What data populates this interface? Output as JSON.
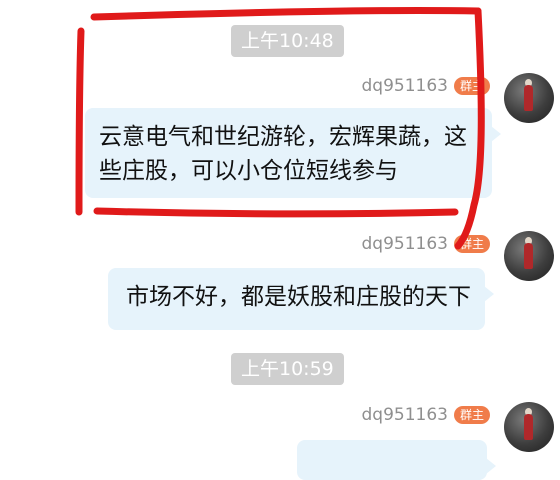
{
  "messages": [
    {
      "time": "上午10:48",
      "sender": "dq951163",
      "role": "群主",
      "text": "云意电气和世纪游轮，宏辉果蔬，这些庄股，可以小仓位短线参与"
    },
    {
      "sender": "dq951163",
      "role": "群主",
      "text": "市场不好，都是妖股和庄股的天下"
    },
    {
      "time": "上午10:59",
      "sender": "dq951163",
      "role": "群主"
    }
  ],
  "colors": {
    "bubble": "#e6f3fb",
    "badge": "#f07c4a",
    "time_badge": "#cfcfcf",
    "annotation": "#e01a1a"
  },
  "icons": {
    "avatar": "person-in-red-avatar-icon"
  }
}
